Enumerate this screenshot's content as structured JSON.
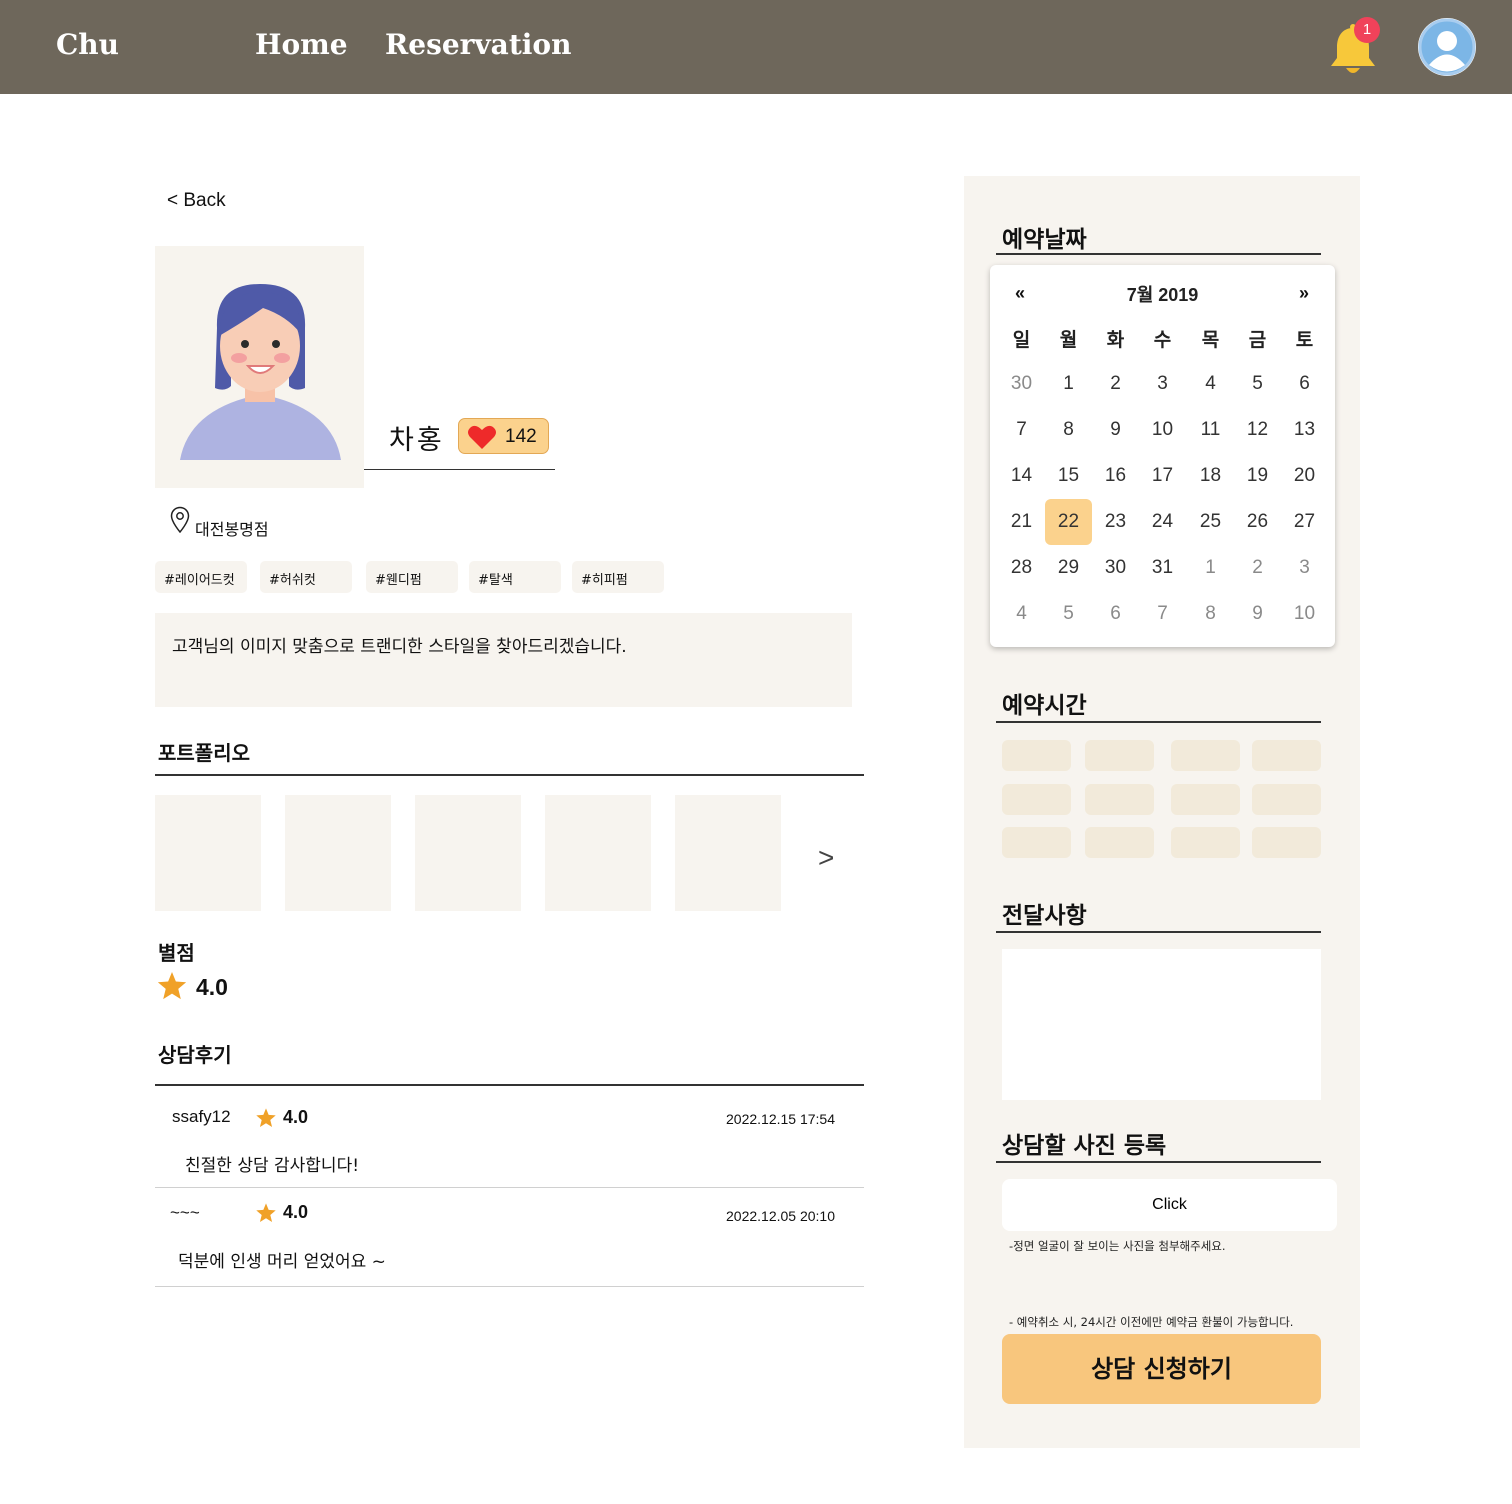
{
  "header": {
    "brand": "Chu",
    "nav": [
      "Home",
      "Reservation"
    ],
    "notification_count": "1",
    "colors": {
      "bar": "#6e675b",
      "bell": "#f7c83a",
      "badge": "#f0425a",
      "avatar": "#7cb6e6"
    }
  },
  "back_label": "< Back",
  "designer": {
    "name": "차홍",
    "likes": "142",
    "location": "대전봉명점",
    "tags": [
      "#레이어드컷",
      "#허쉬컷",
      "#웬디펌",
      "#탈색",
      "#히피펌"
    ],
    "intro": "고객님의 이미지 맞춤으로 트랜디한 스타일을 찾아드리겠습니다."
  },
  "portfolio": {
    "title": "포트폴리오",
    "next": ">"
  },
  "rating": {
    "title": "별점",
    "value": "4.0"
  },
  "reviews": {
    "title": "상담후기",
    "items": [
      {
        "user": "ssafy12",
        "rating": "4.0",
        "date": "2022.12.15 17:54",
        "text": "친절한 상담 감사합니다!"
      },
      {
        "user": "~~~",
        "rating": "4.0",
        "date": "2022.12.05 20:10",
        "text": "덕분에 인생 머리 얻었어요 ~"
      }
    ]
  },
  "booking": {
    "date_title": "예약날짜",
    "calendar": {
      "prev": "«",
      "next": "»",
      "month_label": "7월 2019",
      "weekdays": [
        "일",
        "월",
        "화",
        "수",
        "목",
        "금",
        "토"
      ],
      "weeks": [
        [
          "30",
          "1",
          "2",
          "3",
          "4",
          "5",
          "6"
        ],
        [
          "7",
          "8",
          "9",
          "10",
          "11",
          "12",
          "13"
        ],
        [
          "14",
          "15",
          "16",
          "17",
          "18",
          "19",
          "20"
        ],
        [
          "21",
          "22",
          "23",
          "24",
          "25",
          "26",
          "27"
        ],
        [
          "28",
          "29",
          "30",
          "31",
          "1",
          "2",
          "3"
        ],
        [
          "4",
          "5",
          "6",
          "7",
          "8",
          "9",
          "10"
        ]
      ],
      "selected": "22"
    },
    "time_title": "예약시간",
    "message_title": "전달사항",
    "photo_title": "상담할 사진 등록",
    "upload_label": "Click",
    "photo_note": "-정면 얼굴이 잘 보이는 사진을 첨부해주세요.",
    "cancel_note": "- 예약취소 시, 24시간 이전에만 예약금 환불이 가능합니다.",
    "submit_label": "상담 신청하기",
    "accent_color": "#f8c67d"
  }
}
